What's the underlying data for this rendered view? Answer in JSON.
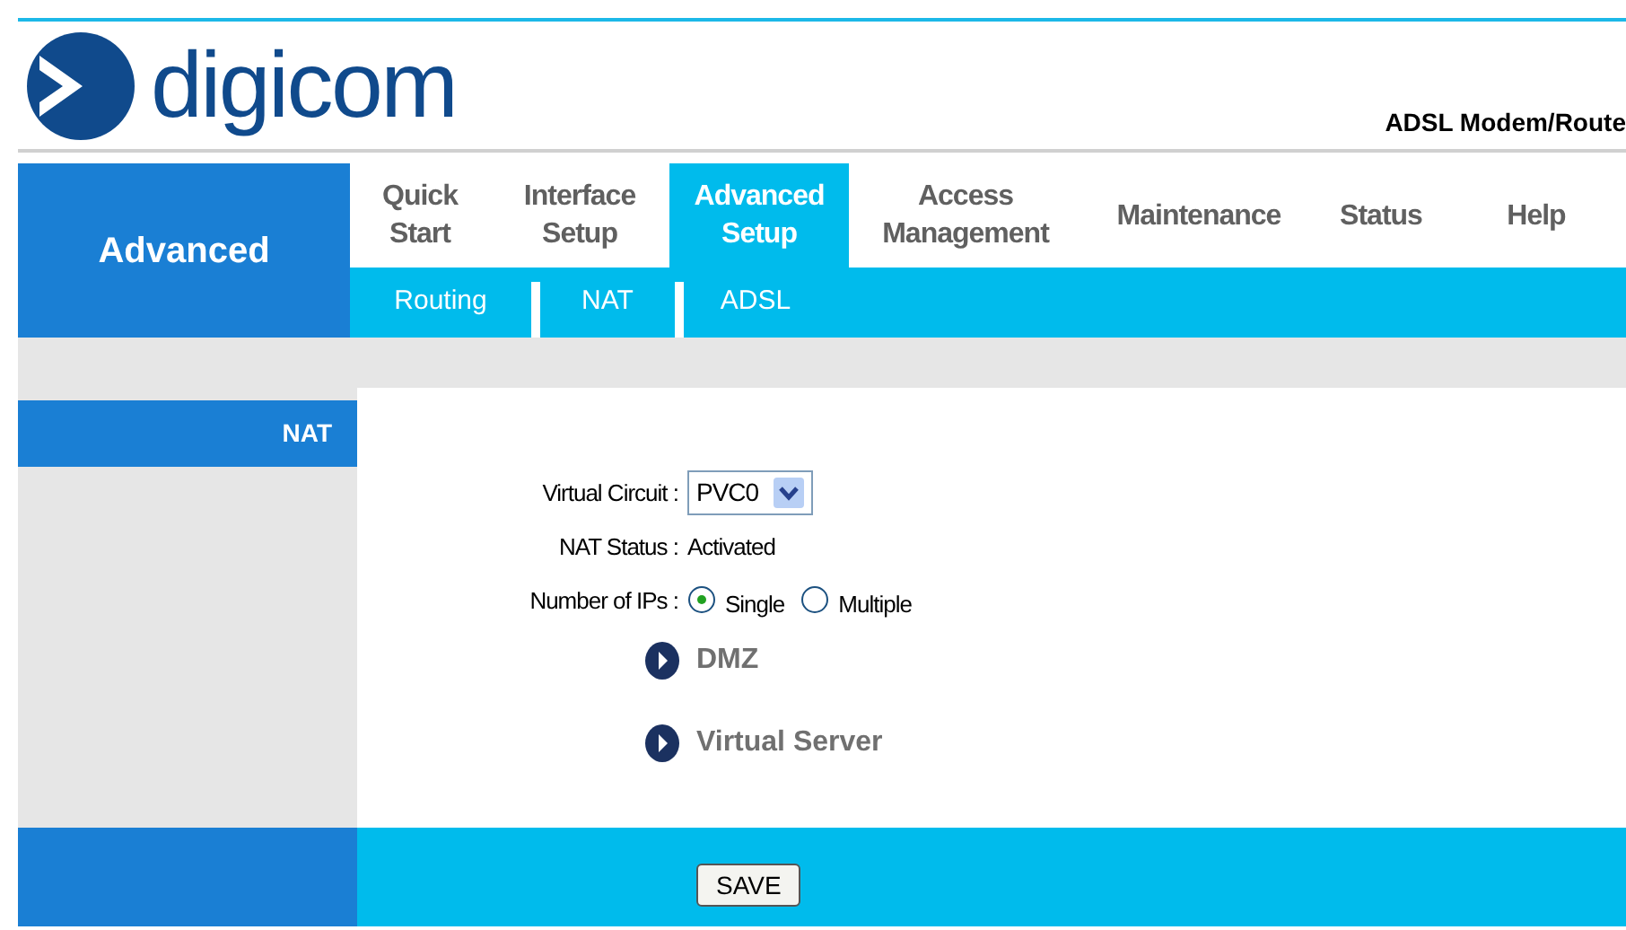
{
  "logo": {
    "text": "digicom"
  },
  "product": "ADSL Modem/Route",
  "section_title": "Advanced",
  "tabs": [
    {
      "label": "Quick Start",
      "selected": false
    },
    {
      "label": "Interface Setup",
      "selected": false
    },
    {
      "label": "Advanced Setup",
      "selected": true
    },
    {
      "label": "Access Management",
      "selected": false
    },
    {
      "label": "Maintenance",
      "selected": false
    },
    {
      "label": "Status",
      "selected": false
    },
    {
      "label": "Help",
      "selected": false
    }
  ],
  "subtabs": [
    "Routing",
    "NAT",
    "ADSL"
  ],
  "sidebar": {
    "heading": "NAT"
  },
  "form": {
    "virtual_circuit": {
      "label": "Virtual Circuit :",
      "value": "PVC0"
    },
    "nat_status": {
      "label": "NAT Status :",
      "value": "Activated"
    },
    "number_of_ips": {
      "label": "Number of IPs :",
      "options": [
        {
          "label": "Single",
          "selected": true
        },
        {
          "label": "Multiple",
          "selected": false
        }
      ]
    }
  },
  "links": [
    "DMZ",
    "Virtual Server"
  ],
  "buttons": [
    "SAVE"
  ]
}
